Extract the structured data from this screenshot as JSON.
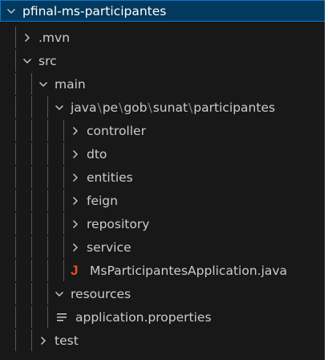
{
  "explorer": {
    "root": {
      "label": "pfinal-ms-participantes",
      "state": "expanded"
    },
    "items": [
      {
        "label": "pfinal-ms-participantes",
        "kind": "folder",
        "state": "expanded",
        "depth": 0
      },
      {
        "label": ".mvn",
        "kind": "folder",
        "state": "collapsed",
        "depth": 1
      },
      {
        "label": "src",
        "kind": "folder",
        "state": "expanded",
        "depth": 1
      },
      {
        "label": "main",
        "kind": "folder",
        "state": "expanded",
        "depth": 2
      },
      {
        "label": "java\\pe\\gob\\sunat\\participantes",
        "kind": "folder",
        "state": "expanded",
        "depth": 3,
        "segments": [
          "java",
          "pe",
          "gob",
          "sunat",
          "participantes"
        ],
        "separator": "\\"
      },
      {
        "label": "controller",
        "kind": "folder",
        "state": "collapsed",
        "depth": 4
      },
      {
        "label": "dto",
        "kind": "folder",
        "state": "collapsed",
        "depth": 4
      },
      {
        "label": "entities",
        "kind": "folder",
        "state": "collapsed",
        "depth": 4
      },
      {
        "label": "feign",
        "kind": "folder",
        "state": "collapsed",
        "depth": 4
      },
      {
        "label": "repository",
        "kind": "folder",
        "state": "collapsed",
        "depth": 4
      },
      {
        "label": "service",
        "kind": "folder",
        "state": "collapsed",
        "depth": 4
      },
      {
        "label": "MsParticipantesApplication.java",
        "kind": "file",
        "icon": "java-file-icon",
        "depth": 4
      },
      {
        "label": "resources",
        "kind": "folder",
        "state": "expanded",
        "depth": 3
      },
      {
        "label": "application.properties",
        "kind": "file",
        "icon": "properties-file-icon",
        "depth": 4
      },
      {
        "label": "test",
        "kind": "folder",
        "state": "collapsed",
        "depth": 2
      }
    ],
    "java_icon_glyph": "J",
    "colors": {
      "background": "#181818",
      "text": "#cccccc",
      "selected_background": "#04395e",
      "selected_border": "#0078d4",
      "java_icon": "#f04e23",
      "indent_guide": "#585858"
    }
  }
}
